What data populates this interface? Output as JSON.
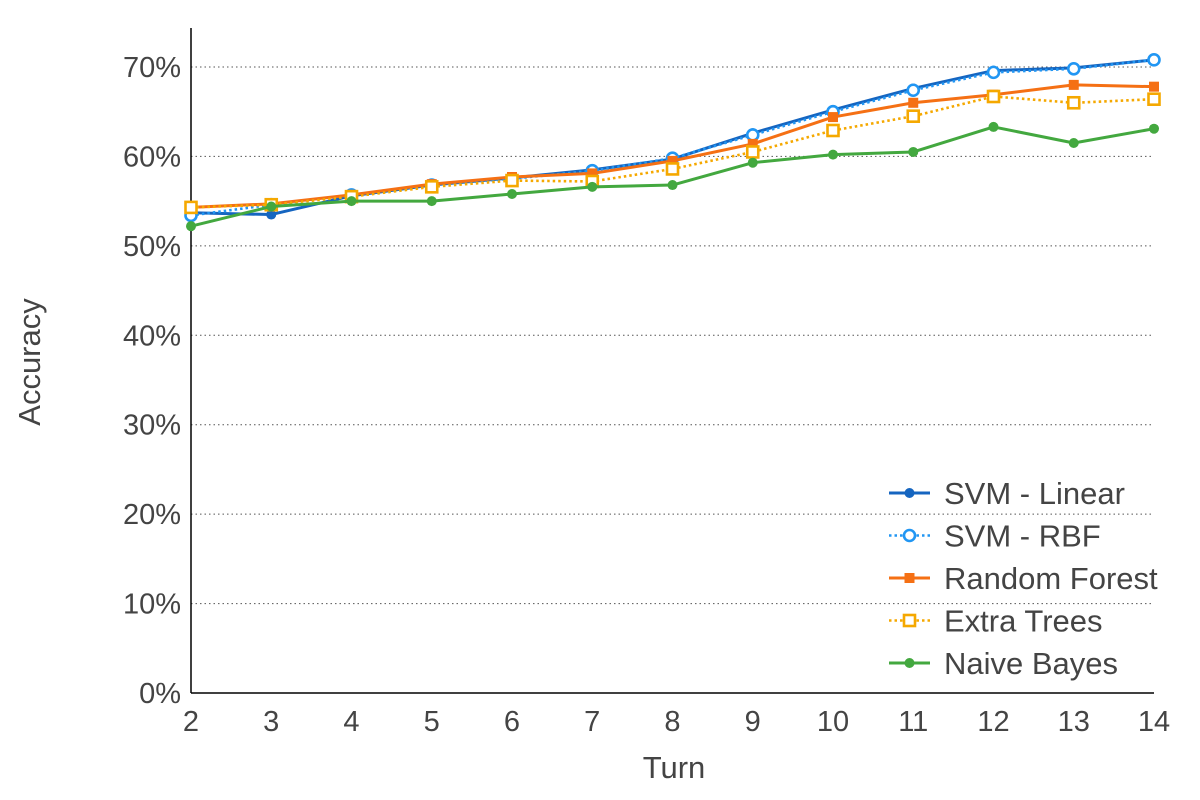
{
  "chart_data": {
    "type": "line",
    "title": "",
    "xlabel": "Turn",
    "ylabel": "Accuracy",
    "x": [
      2,
      3,
      4,
      5,
      6,
      7,
      8,
      9,
      10,
      11,
      12,
      13,
      14
    ],
    "xlim": [
      2,
      14
    ],
    "ylim": [
      0,
      0.7
    ],
    "yticks": [
      0,
      0.1,
      0.2,
      0.3,
      0.4,
      0.5,
      0.6,
      0.7
    ],
    "ytick_labels": [
      "0%",
      "10%",
      "20%",
      "30%",
      "40%",
      "50%",
      "60%",
      "70%"
    ],
    "xtick_labels": [
      "2",
      "3",
      "4",
      "5",
      "6",
      "7",
      "8",
      "9",
      "10",
      "11",
      "12",
      "13",
      "14"
    ],
    "grid": "horizontal-dotted",
    "legend_position": "bottom-right",
    "series": [
      {
        "name": "SVM - Linear",
        "color": "#1565c0",
        "line": "solid",
        "marker": "filled-circle",
        "values": [
          0.537,
          0.535,
          0.556,
          0.568,
          0.576,
          0.585,
          0.597,
          0.626,
          0.652,
          0.676,
          0.696,
          0.699,
          0.708
        ]
      },
      {
        "name": "SVM - RBF",
        "color": "#2196f3",
        "line": "dotted",
        "marker": "hollow-circle",
        "values": [
          0.534,
          0.546,
          0.557,
          0.568,
          0.575,
          0.584,
          0.598,
          0.624,
          0.65,
          0.674,
          0.694,
          0.698,
          0.708
        ]
      },
      {
        "name": "Random Forest",
        "color": "#f57014",
        "line": "solid",
        "marker": "filled-square",
        "values": [
          0.543,
          0.547,
          0.557,
          0.569,
          0.577,
          0.581,
          0.595,
          0.614,
          0.644,
          0.66,
          0.669,
          0.68,
          0.678
        ]
      },
      {
        "name": "Extra Trees",
        "color": "#f5a800",
        "line": "dotted",
        "marker": "hollow-square",
        "values": [
          0.543,
          0.546,
          0.555,
          0.566,
          0.573,
          0.572,
          0.586,
          0.605,
          0.629,
          0.645,
          0.667,
          0.66,
          0.664
        ]
      },
      {
        "name": "Naive Bayes",
        "color": "#43a83f",
        "line": "solid",
        "marker": "filled-circle",
        "values": [
          0.522,
          0.544,
          0.55,
          0.55,
          0.558,
          0.566,
          0.568,
          0.593,
          0.602,
          0.605,
          0.633,
          0.615,
          0.631
        ]
      }
    ]
  }
}
